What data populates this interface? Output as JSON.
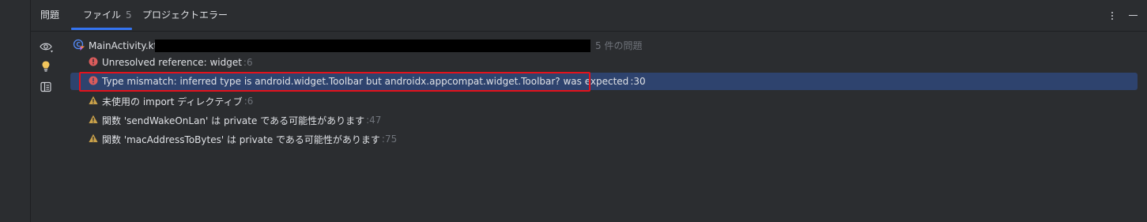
{
  "tabs": {
    "problems_label": "問題",
    "file_label": "ファイル",
    "file_count": "5",
    "project_errors_label": "プロジェクトエラー"
  },
  "file": {
    "name": "MainActivity.kt",
    "problem_count": "5 件の問題"
  },
  "issues": [
    {
      "severity": "error",
      "text": "Unresolved reference: widget",
      "line": ":6"
    },
    {
      "severity": "error",
      "text": "Type mismatch: inferred type is android.widget.Toolbar but androidx.appcompat.widget.Toolbar? was expected",
      "line": ":30"
    },
    {
      "severity": "warning",
      "text": "未使用の import ディレクティブ",
      "line": ":6"
    },
    {
      "severity": "warning",
      "text": "関数 'sendWakeOnLan' は private である可能性があります",
      "line": ":47"
    },
    {
      "severity": "warning",
      "text": "関数 'macAddressToBytes' は private である可能性があります",
      "line": ":75"
    }
  ],
  "colors": {
    "error": "#db5c5c",
    "warning": "#c9a14a",
    "selection": "#2e436e",
    "highlight_box": "#e3121b",
    "accent": "#3574f0"
  },
  "icons": {
    "toolbar": [
      "eye-icon",
      "lightbulb-icon",
      "preview-icon"
    ],
    "tab_actions": [
      "more-options-icon",
      "minimize-icon"
    ],
    "file": "kotlin-class-icon"
  }
}
